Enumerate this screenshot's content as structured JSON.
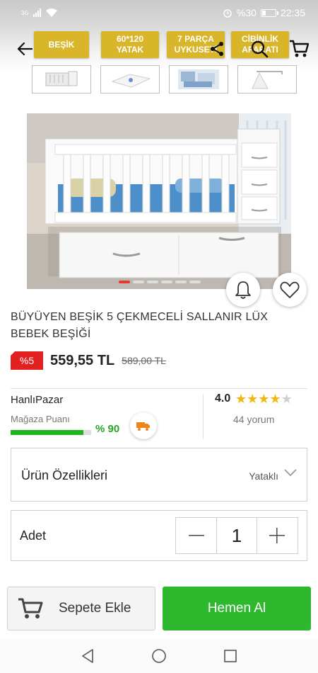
{
  "status_bar": {
    "signal": "3G",
    "battery": "%30",
    "battery_level": 0.3,
    "time": "22:35"
  },
  "top_nav": {
    "tags": [
      "BEŞİK",
      "60*120\nYATAK",
      "7 PARÇA\nUYKUSETİ",
      "CİBİNLİK\nAPARATI"
    ],
    "icons": [
      "back-arrow-icon",
      "share-icon",
      "search-icon",
      "cart-icon"
    ]
  },
  "thumbnails": [
    "crib-thumbnail",
    "mattress-thumbnail",
    "bedding-set-thumbnail",
    "canopy-thumbnail"
  ],
  "carousel": {
    "dot_count": 6,
    "active_index": 0
  },
  "product": {
    "title": "BÜYÜYEN BEŞİK 5 ÇEKMECELİ SALLANIR LÜX BEBEK BEŞİĞİ",
    "discount": "%5",
    "price": "559,55 TL",
    "old_price": "589,00 TL"
  },
  "store": {
    "name": "HanlıPazar",
    "rating_label": "Mağaza Puanı",
    "score_pct": "% 90",
    "score_value": 0.9,
    "rating": "4.0",
    "stars_filled": 4,
    "stars_total": 5,
    "reviews": "44 yorum"
  },
  "features": {
    "label": "Ürün Özellikleri",
    "value": "Yataklı"
  },
  "quantity": {
    "label": "Adet",
    "value": "1"
  },
  "actions": {
    "add_to_cart": "Sepete Ekle",
    "buy_now": "Hemen Al"
  },
  "colors": {
    "accent_green": "#2db82d",
    "discount_red": "#e32020",
    "tag_gold": "#d9b52a",
    "star_gold": "#f5b50a"
  }
}
